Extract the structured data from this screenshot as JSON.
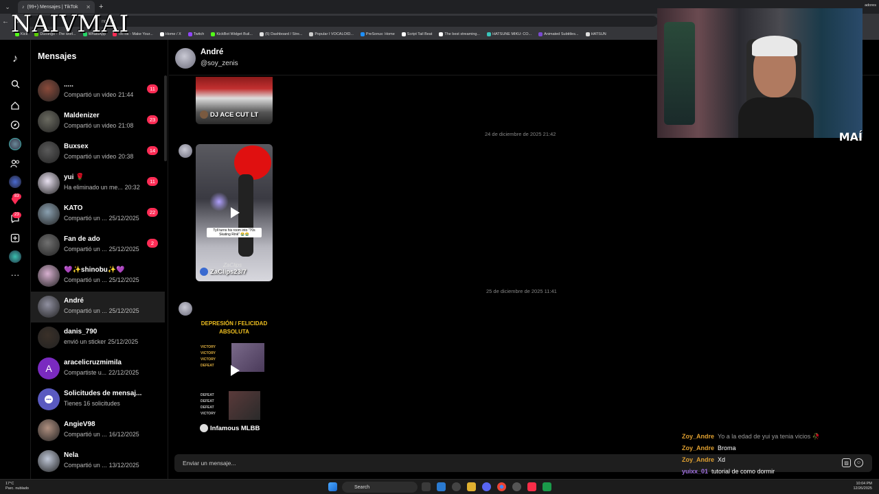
{
  "browser": {
    "tab_title": "(99+) Mensajes | TikTok",
    "url": "ng=es",
    "bookmarks": [
      "Kick",
      "Duolingo - The worl...",
      "WhatsApp",
      "TikTok - Make Your...",
      "Home / X",
      "Twitch",
      "KickBot Widget Buil...",
      "(5) Dashboard / Stre...",
      "Popular I VOCALOID...",
      "PreSonus: Home",
      "Script Tail Beat",
      "The best streaming...",
      "HATSUNE MIKU: CO...",
      "Animated Subtitles...",
      "HATSUN"
    ],
    "bookmarks_right": "adores"
  },
  "stream": {
    "brand": "NAIVMAI",
    "webcam_tag": "MAÍ",
    "chat": [
      {
        "user": "Zoy_Andre",
        "message": "Yo a la edad de yui ya tenia vicios 🥀",
        "color": "#e0a030",
        "msg_color": "#999999"
      },
      {
        "user": "Zoy_Andre",
        "message": "Broma",
        "color": "#e0a030",
        "msg_color": "#ffffff"
      },
      {
        "user": "Zoy_Andre",
        "message": "Xd",
        "color": "#e0a030",
        "msg_color": "#ffffff"
      },
      {
        "user": "yuixx_01",
        "message": "tutorial de como dormir",
        "color": "#a070e0",
        "msg_color": "#ffffff"
      }
    ]
  },
  "rail": {
    "badges": [
      "83",
      "23"
    ]
  },
  "sidebar": {
    "title": "Mensajes",
    "conversations": [
      {
        "name": ".....",
        "sub": "Compartió un video",
        "time": "21:44",
        "badge": "11",
        "avatar_color": "#8a4a3a"
      },
      {
        "name": "Maldenizer",
        "sub": "Compartió un video",
        "time": "21:08",
        "badge": "23",
        "avatar_color": "#6a6a60"
      },
      {
        "name": "Buxsex",
        "sub": "Compartió un video",
        "time": "20:38",
        "badge": "14",
        "avatar_color": "#5a5a5a"
      },
      {
        "name": "yui 🌹",
        "sub": "Ha eliminado un me...",
        "time": "20:32",
        "badge": "11",
        "avatar_color": "#e8e0f0"
      },
      {
        "name": "KATO",
        "sub": "Compartió un ...",
        "time": "25/12/2025",
        "badge": "22",
        "avatar_color": "#8aa0b0"
      },
      {
        "name": "Fan de ado",
        "sub": "Compartió un ...",
        "time": "25/12/2025",
        "badge": "2",
        "avatar_color": "#707070"
      },
      {
        "name": "💜✨shinobu✨💜",
        "sub": "Compartió un ...",
        "time": "25/12/2025",
        "badge": "",
        "avatar_color": "#d8b0d0"
      },
      {
        "name": "André",
        "sub": "Compartió un ...",
        "time": "25/12/2025",
        "badge": "",
        "avatar_color": "#9090a0",
        "active": true
      },
      {
        "name": "danis_790",
        "sub": "envió un sticker",
        "time": "25/12/2025",
        "badge": "",
        "avatar_color": "#3a3028"
      },
      {
        "name": "aracelicruzmimila",
        "sub": "Compartiste u...",
        "time": "22/12/2025",
        "badge": "",
        "avatar_color": "#7a2ac0",
        "letter": "A"
      },
      {
        "name": "Solicitudes de mensaj...",
        "sub": "Tienes 16 solicitudes",
        "time": "",
        "badge": "",
        "avatar_color": "#5a5ac0"
      },
      {
        "name": "AngieV98",
        "sub": "Compartió un ...",
        "time": "16/12/2025",
        "badge": "",
        "avatar_color": "#b09080"
      },
      {
        "name": "Nela",
        "sub": "Compartió un ...",
        "time": "13/12/2025",
        "badge": "",
        "avatar_color": "#c0c8d8"
      }
    ]
  },
  "chat": {
    "name": "André",
    "handle": "@soy_zenis",
    "date_1": "24 de diciembre de 2025 21:42",
    "date_2": "25 de diciembre de 2025 11:41",
    "video_1_caption": "DJ ACE CUT LT",
    "video_2_caption": "ZaClips23/7",
    "video_2_text": "Tyll turns his room into \"70s Skating Rink\" 😭😭",
    "video_2_watermark": "ZaClips",
    "video_3_caption": "Infamous MLBB",
    "video_3_title": "DEPRESIÓN / FELICIDAD ABSOLUTA",
    "video_3_list_a": [
      "VICTORY",
      "VICTORY",
      "VICTORY",
      "DEFEAT"
    ],
    "video_3_list_b": [
      "DEFEAT",
      "DEFEAT",
      "DEFEAT",
      "VICTORY"
    ],
    "input_placeholder": "Enviar un mensaje..."
  },
  "taskbar": {
    "temp": "17°C",
    "weather": "Parc. nublado",
    "search": "Search",
    "time": "10:04 PM",
    "date": "12/26/2025"
  }
}
